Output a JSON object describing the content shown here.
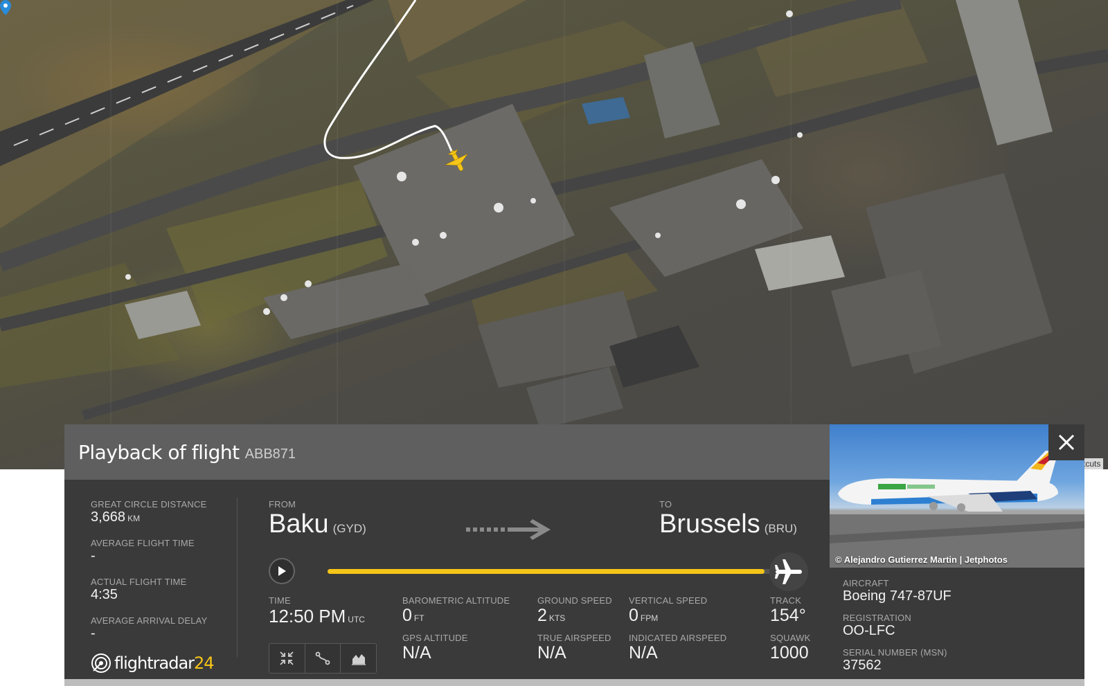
{
  "map": {
    "shortcuts_label": "tcuts"
  },
  "panel": {
    "title": "Playback of flight",
    "flight_number": "ABB871",
    "stats": [
      {
        "label": "GREAT CIRCLE DISTANCE",
        "value": "3,668",
        "unit": "KM"
      },
      {
        "label": "AVERAGE FLIGHT TIME",
        "value": "-",
        "unit": ""
      },
      {
        "label": "ACTUAL FLIGHT TIME",
        "value": "4:35",
        "unit": ""
      },
      {
        "label": "AVERAGE ARRIVAL DELAY",
        "value": "-",
        "unit": ""
      }
    ],
    "logo": {
      "text": "flightradar",
      "number": "24"
    },
    "from": {
      "label": "FROM",
      "city": "Baku",
      "code": "(GYD)"
    },
    "to": {
      "label": "TO",
      "city": "Brussels",
      "code": "(BRU)"
    },
    "playback_progress": 0.97,
    "time": {
      "label": "TIME",
      "value": "12:50 PM",
      "unit": "UTC"
    },
    "baro_alt": {
      "label": "BAROMETRIC ALTITUDE",
      "value": "0",
      "unit": "FT"
    },
    "ground_speed": {
      "label": "GROUND SPEED",
      "value": "2",
      "unit": "KTS"
    },
    "vertical_speed": {
      "label": "VERTICAL SPEED",
      "value": "0",
      "unit": "FPM"
    },
    "track": {
      "label": "TRACK",
      "value": "154°"
    },
    "gps_alt": {
      "label": "GPS ALTITUDE",
      "value": "N/A"
    },
    "true_airspeed": {
      "label": "TRUE AIRSPEED",
      "value": "N/A"
    },
    "indicated_airspeed": {
      "label": "INDICATED AIRSPEED",
      "value": "N/A"
    },
    "squawk": {
      "label": "SQUAWK",
      "value": "1000"
    },
    "icons": [
      "collapse-icon",
      "route-icon",
      "altitude-graph-icon"
    ]
  },
  "side": {
    "photo_credit": "© Alejandro Gutierrez Martin | Jetphotos",
    "aircraft": {
      "label": "AIRCRAFT",
      "value": "Boeing 747-87UF"
    },
    "registration": {
      "label": "REGISTRATION",
      "value": "OO-LFC"
    },
    "serial": {
      "label": "SERIAL NUMBER (MSN)",
      "value": "37562"
    }
  },
  "colors": {
    "accent": "#f5c518",
    "panel": "#3a3a3a",
    "header": "#5f5f5f"
  }
}
